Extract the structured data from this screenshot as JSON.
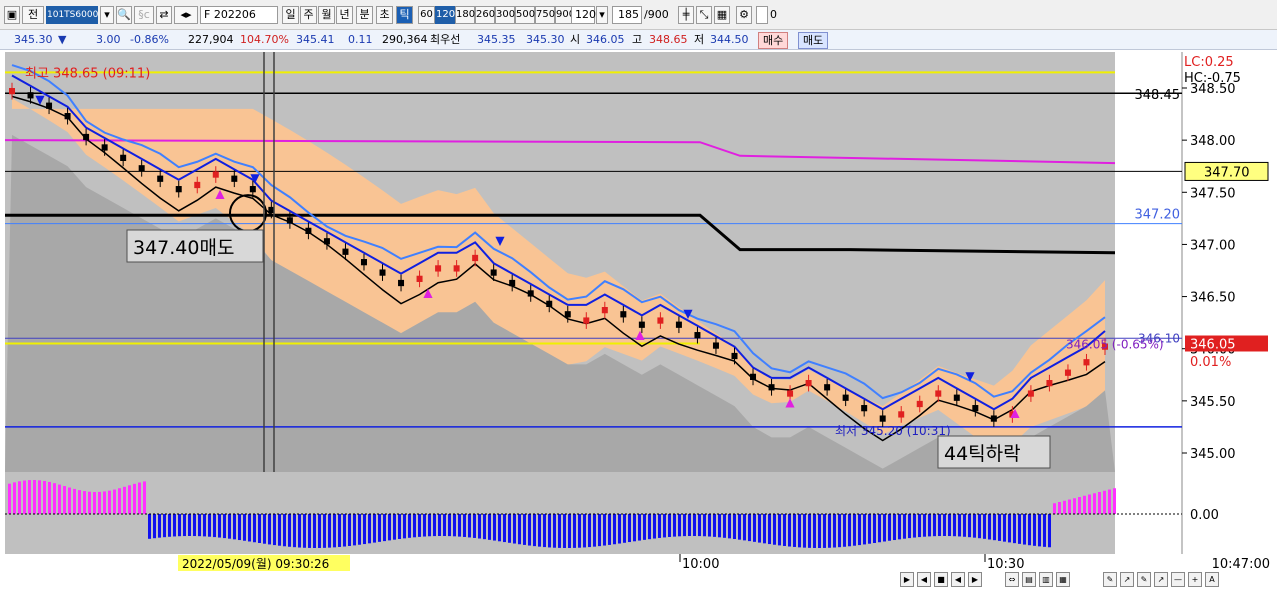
{
  "toolbar": {
    "menu1": "전",
    "code": "101TS6000",
    "f_label": "F",
    "contract": "202206",
    "periods": [
      "일",
      "주",
      "월",
      "년",
      "분",
      "초",
      "틱"
    ],
    "active_period": "틱",
    "ticks": [
      "60",
      "120",
      "180",
      "260",
      "300",
      "500",
      "750",
      "900"
    ],
    "selected_tick": "120",
    "tick_value": "120",
    "count": "185",
    "count_total": "/900",
    "checkbox_label": "0"
  },
  "quote": {
    "price": "345.30",
    "change": "3.00",
    "change_pct": "-0.86%",
    "volume": "227,904",
    "vol_ratio": "104.70%",
    "theory": "345.41",
    "basis": "0.11",
    "open_int": "290,364",
    "best_label": "최우선",
    "ask": "345.35",
    "bid": "345.30",
    "open_label": "시",
    "open": "346.05",
    "high_label": "고",
    "high": "348.65",
    "low_label": "저",
    "low": "344.50",
    "buy_label": "매수",
    "sell_label": "매도"
  },
  "chart": {
    "lc_label": "LC:0.25",
    "hc_label": "HC:-0.75",
    "high_annotation": "최고 348.65 (09:11)",
    "low_annotation": "최저 345.20 (10:31)",
    "sell_note": "347.40매도",
    "drop_note": "44틱하락",
    "current_label": "346.05",
    "pct_label": "0.01%",
    "last_annotation": "346.05 (-0.65%)",
    "level_348_45": "348.45",
    "level_347_20": "347.20",
    "level_346_10": "346.10",
    "level_347_70": "347.70",
    "y_ticks": [
      "348.50",
      "348.00",
      "347.50",
      "347.00",
      "346.50",
      "346.00",
      "345.50",
      "345.00"
    ],
    "osc_zero": "0.00",
    "date_label": "05/09",
    "cursor_time": "2022/05/09(월) 09:30:26",
    "x_ticks": [
      "10:00",
      "10:30"
    ],
    "time_right": "10:47:00"
  },
  "colors": {
    "cloud": "#ffc896",
    "bull": "#e02020",
    "bear": "#000000",
    "ma_blue": "#1020e0",
    "ma_light": "#4080ff",
    "magenta": "#e020e0",
    "yellow": "#f0f000"
  },
  "chart_data": {
    "type": "candlestick",
    "y_axis": [
      345.0,
      348.5
    ],
    "series": [
      {
        "name": "price",
        "values": [
          348.5,
          348.4,
          348.3,
          348.2,
          348.0,
          347.9,
          347.8,
          347.7,
          347.6,
          347.5,
          347.6,
          347.7,
          347.6,
          347.5,
          347.3,
          347.2,
          347.1,
          347.0,
          346.9,
          346.8,
          346.7,
          346.6,
          346.7,
          346.8,
          346.8,
          346.9,
          346.7,
          346.6,
          346.5,
          346.4,
          346.3,
          346.3,
          346.4,
          346.3,
          346.2,
          346.3,
          346.2,
          346.1,
          346.0,
          345.9,
          345.7,
          345.6,
          345.6,
          345.7,
          345.6,
          345.5,
          345.4,
          345.3,
          345.4,
          345.5,
          345.6,
          345.5,
          345.4,
          345.3,
          345.4,
          345.6,
          345.7,
          345.8,
          345.9,
          346.05
        ]
      }
    ]
  }
}
